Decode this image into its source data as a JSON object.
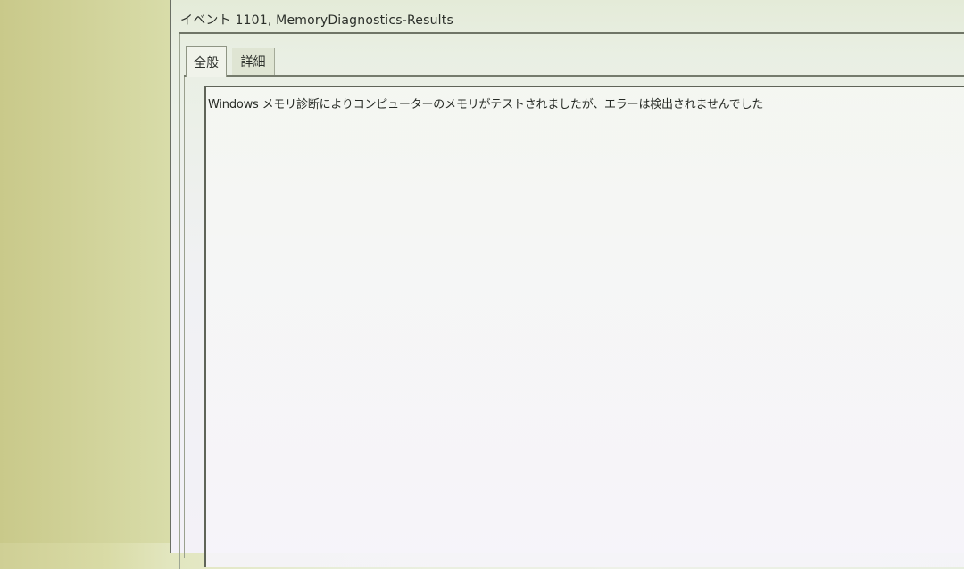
{
  "window": {
    "title": "イベント 1101, MemoryDiagnostics-Results"
  },
  "tabs": [
    {
      "label": "全般",
      "active": true
    },
    {
      "label": "詳細",
      "active": false
    }
  ],
  "general": {
    "message": "Windows メモリ診断によりコンピューターのメモリがテストされましたが、エラーは検出されませんでした"
  }
}
